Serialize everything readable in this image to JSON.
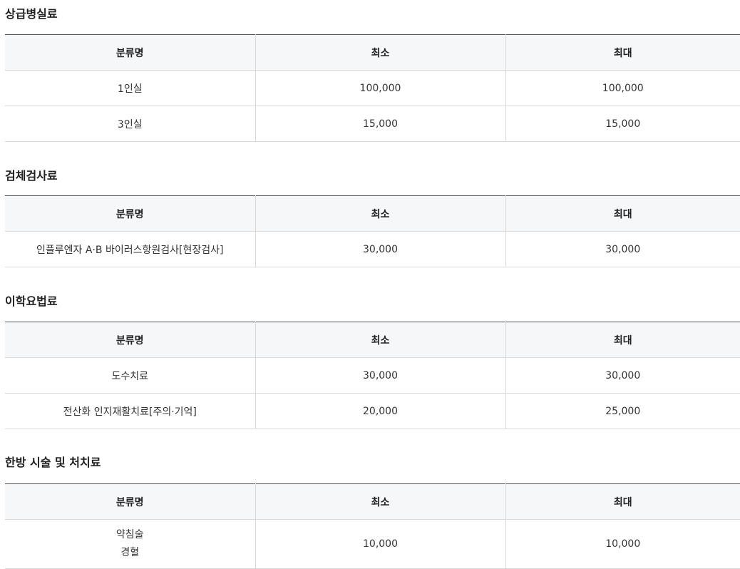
{
  "columns": {
    "name": "분류명",
    "min": "최소",
    "max": "최대"
  },
  "sections": [
    {
      "title": "상급병실료",
      "rows": [
        {
          "name": "1인실",
          "min": "100,000",
          "max": "100,000"
        },
        {
          "name": "3인실",
          "min": "15,000",
          "max": "15,000"
        }
      ]
    },
    {
      "title": "검체검사료",
      "rows": [
        {
          "name": "인플루엔자 A·B 바이러스항원검사[현장검사]",
          "min": "30,000",
          "max": "30,000"
        }
      ]
    },
    {
      "title": "이학요법료",
      "rows": [
        {
          "name": "도수치료",
          "min": "30,000",
          "max": "30,000"
        },
        {
          "name": "전산화 인지재활치료[주의·기억]",
          "min": "20,000",
          "max": "25,000"
        }
      ]
    },
    {
      "title": "한방 시술 및 처치료",
      "rows": [
        {
          "name_lines": [
            "약침술",
            "경혈"
          ],
          "min": "10,000",
          "max": "10,000"
        }
      ]
    }
  ]
}
